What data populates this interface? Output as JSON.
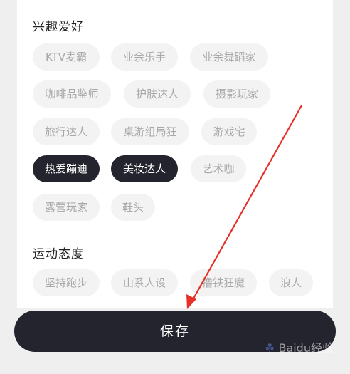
{
  "sections": [
    {
      "title": "兴趣爱好",
      "tags": [
        {
          "label": "KTV麦霸",
          "selected": false
        },
        {
          "label": "业余乐手",
          "selected": false
        },
        {
          "label": "业余舞蹈家",
          "selected": false
        },
        {
          "label": "咖啡品鉴师",
          "selected": false
        },
        {
          "label": "护肤达人",
          "selected": false
        },
        {
          "label": "摄影玩家",
          "selected": false
        },
        {
          "label": "旅行达人",
          "selected": false
        },
        {
          "label": "桌游组局狂",
          "selected": false
        },
        {
          "label": "游戏宅",
          "selected": false
        },
        {
          "label": "热爱蹦迪",
          "selected": true
        },
        {
          "label": "美妆达人",
          "selected": true
        },
        {
          "label": "艺术咖",
          "selected": false
        },
        {
          "label": "露营玩家",
          "selected": false
        },
        {
          "label": "鞋头",
          "selected": false
        }
      ]
    },
    {
      "title": "运动态度",
      "tags": [
        {
          "label": "坚持跑步",
          "selected": false
        },
        {
          "label": "山系人设",
          "selected": false
        },
        {
          "label": "撸铁狂魔",
          "selected": false
        },
        {
          "label": "浪人",
          "selected": false
        }
      ]
    }
  ],
  "save_button": {
    "label": "保存"
  },
  "watermark": {
    "text": "Baidu经验"
  },
  "colors": {
    "tag_bg": "#f3f3f3",
    "tag_text": "#a8a8a8",
    "selected_bg": "#23242e",
    "selected_text": "#ffffff",
    "arrow": "#e5312a"
  }
}
